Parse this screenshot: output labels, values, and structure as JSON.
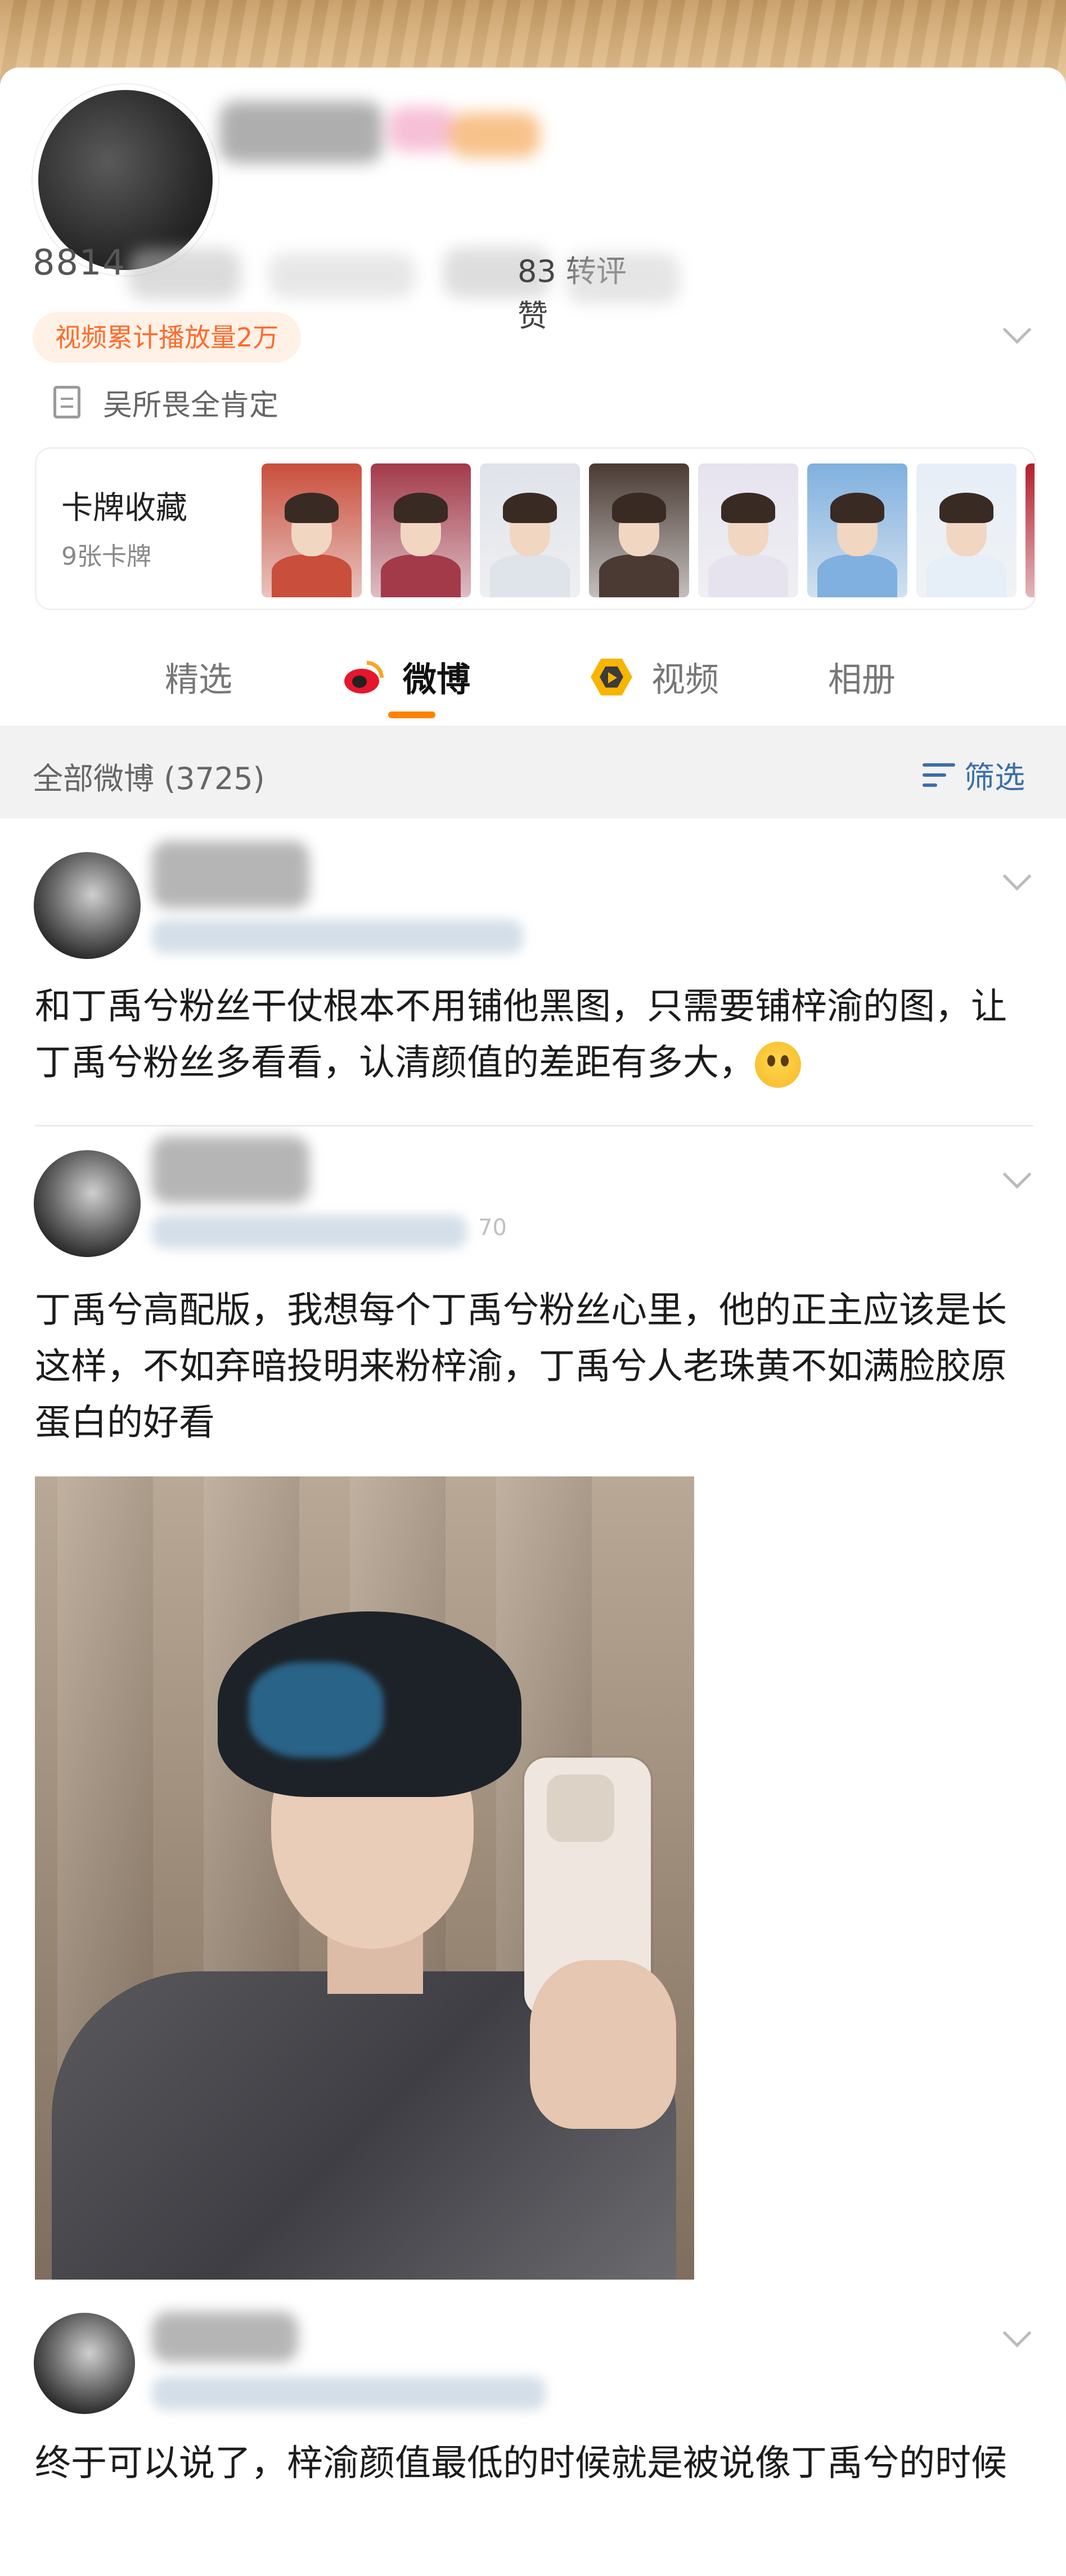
{
  "profile": {
    "stat_number": "8814",
    "stat_label": "转评赞",
    "stat_label_prefix": "83",
    "video_badge": "视频累计播放量2万",
    "verification": "吴所畏全肯定"
  },
  "card_collection": {
    "title": "卡牌收藏",
    "subtitle": "9张卡牌",
    "thumb_colors": [
      "#c94e3c",
      "#a33a4a",
      "#dfe3ea",
      "#4a3a33",
      "#e6e3ef",
      "#7fb0df",
      "#e6eef7",
      "#b31f2c"
    ]
  },
  "tabs": [
    {
      "label": "精选",
      "icon": null
    },
    {
      "label": "微博",
      "icon": "weibo-logo-icon",
      "active": true
    },
    {
      "label": "视频",
      "icon": "video-hexagon-icon"
    },
    {
      "label": "相册",
      "icon": null
    }
  ],
  "filter_bar": {
    "count_label": "全部微博 (3725)",
    "filter_label": "筛选"
  },
  "posts": [
    {
      "meta_tail": "",
      "text": "和丁禹兮粉丝干仗根本不用铺他黑图，只需要铺梓渝的图，让丁禹兮粉丝多看看，认清颜值的差距有多大，"
    },
    {
      "meta_tail": "70",
      "text": "丁禹兮高配版，我想每个丁禹兮粉丝心里，他的正主应该是长这样，不如弃暗投明来粉梓渝，丁禹兮人老珠黄不如满脸胶原蛋白的好看"
    },
    {
      "meta_tail": "",
      "text": "终于可以说了，梓渝颜值最低的时候就是被说像丁禹兮的时候"
    }
  ],
  "colors": {
    "accent_orange": "#ff8200",
    "badge_text": "#ff6b2c",
    "filter_blue": "#3c6ea8",
    "weibo_red": "#e6162d"
  }
}
